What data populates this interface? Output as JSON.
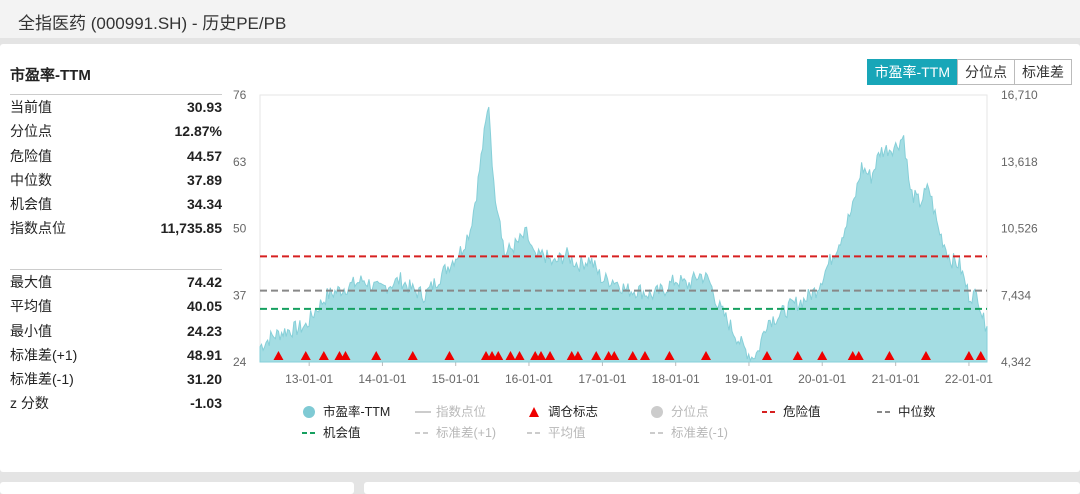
{
  "window": {
    "title": "全指医药 (000991.SH) - 历史PE/PB"
  },
  "panel": {
    "title": "市盈率-TTM"
  },
  "tabs": [
    {
      "label": "市盈率-TTM",
      "active": true
    },
    {
      "label": "分位点",
      "active": false
    },
    {
      "label": "标准差",
      "active": false
    }
  ],
  "stats_current": [
    {
      "label": "当前值",
      "value": "30.93"
    },
    {
      "label": "分位点",
      "value": "12.87%"
    },
    {
      "label": "危险值",
      "value": "44.57"
    },
    {
      "label": "中位数",
      "value": "37.89"
    },
    {
      "label": "机会值",
      "value": "34.34"
    },
    {
      "label": "指数点位",
      "value": "11,735.85"
    }
  ],
  "stats_history": [
    {
      "label": "最大值",
      "value": "74.42"
    },
    {
      "label": "平均值",
      "value": "40.05"
    },
    {
      "label": "最小值",
      "value": "24.23"
    },
    {
      "label": "标准差(+1)",
      "value": "48.91"
    },
    {
      "label": "标准差(-1)",
      "value": "31.20"
    },
    {
      "label": "z 分数",
      "value": "-1.03"
    }
  ],
  "colors": {
    "area_fill": "#a4dde3",
    "area_line": "#86cfd8",
    "danger": "#d62020",
    "median": "#888888",
    "opportunity": "#16a060",
    "marker": "#ee0000",
    "accent": "#18a6b8"
  },
  "chart_data": {
    "type": "area",
    "x_start": "2012-05-01",
    "x_end": "2022-04-01",
    "x_ticks": [
      "13-01-01",
      "14-01-01",
      "15-01-01",
      "16-01-01",
      "17-01-01",
      "18-01-01",
      "19-01-01",
      "20-01-01",
      "21-01-01",
      "22-01-01"
    ],
    "y_left": {
      "min": 24,
      "max": 76,
      "ticks": [
        "24",
        "37",
        "50",
        "63",
        "76"
      ]
    },
    "y_right": {
      "min": 4342,
      "max": 16710,
      "ticks": [
        "4,342",
        "7,434",
        "10,526",
        "13,618",
        "16,710"
      ]
    },
    "series": [
      {
        "name": "市盈率-TTM",
        "points": [
          [
            "2012-05-01",
            27
          ],
          [
            "2012-07-01",
            29
          ],
          [
            "2012-09-01",
            30
          ],
          [
            "2012-11-01",
            30.5
          ],
          [
            "2012-12-15",
            31
          ],
          [
            "2013-02-01",
            34
          ],
          [
            "2013-04-01",
            37
          ],
          [
            "2013-06-01",
            38
          ],
          [
            "2013-08-01",
            39
          ],
          [
            "2013-10-01",
            40
          ],
          [
            "2013-12-15",
            38
          ],
          [
            "2014-02-01",
            39
          ],
          [
            "2014-04-01",
            40
          ],
          [
            "2014-06-01",
            38
          ],
          [
            "2014-08-01",
            37
          ],
          [
            "2014-10-01",
            40
          ],
          [
            "2014-12-01",
            43
          ],
          [
            "2015-02-01",
            46
          ],
          [
            "2015-03-15",
            50
          ],
          [
            "2015-04-15",
            57
          ],
          [
            "2015-05-15",
            66
          ],
          [
            "2015-06-15",
            74.4
          ],
          [
            "2015-07-10",
            58
          ],
          [
            "2015-08-10",
            52
          ],
          [
            "2015-09-01",
            45
          ],
          [
            "2015-11-01",
            47
          ],
          [
            "2015-12-20",
            49
          ],
          [
            "2016-02-01",
            44
          ],
          [
            "2016-03-15",
            45
          ],
          [
            "2016-05-01",
            43
          ],
          [
            "2016-07-01",
            45
          ],
          [
            "2016-09-01",
            43
          ],
          [
            "2016-11-01",
            44
          ],
          [
            "2017-01-01",
            40
          ],
          [
            "2017-03-01",
            40
          ],
          [
            "2017-05-01",
            38
          ],
          [
            "2017-07-01",
            38
          ],
          [
            "2017-09-01",
            37
          ],
          [
            "2017-11-01",
            38
          ],
          [
            "2018-01-01",
            40
          ],
          [
            "2018-03-01",
            39
          ],
          [
            "2018-05-01",
            41
          ],
          [
            "2018-06-15",
            40
          ],
          [
            "2018-08-01",
            35
          ],
          [
            "2018-10-01",
            31
          ],
          [
            "2018-12-01",
            27
          ],
          [
            "2019-01-15",
            25
          ],
          [
            "2019-02-15",
            26
          ],
          [
            "2019-04-01",
            32
          ],
          [
            "2019-06-01",
            33
          ],
          [
            "2019-08-01",
            35
          ],
          [
            "2019-10-01",
            36
          ],
          [
            "2019-12-01",
            38
          ],
          [
            "2020-02-01",
            43
          ],
          [
            "2020-04-01",
            48
          ],
          [
            "2020-06-01",
            54
          ],
          [
            "2020-07-15",
            62
          ],
          [
            "2020-09-01",
            60
          ],
          [
            "2020-10-15",
            65
          ],
          [
            "2021-01-01",
            66
          ],
          [
            "2021-02-10",
            68
          ],
          [
            "2021-03-15",
            57
          ],
          [
            "2021-05-01",
            55
          ],
          [
            "2021-06-15",
            58
          ],
          [
            "2021-08-01",
            50
          ],
          [
            "2021-10-01",
            44
          ],
          [
            "2021-11-15",
            43
          ],
          [
            "2022-01-01",
            37
          ],
          [
            "2022-02-15",
            37
          ],
          [
            "2022-03-15",
            32
          ],
          [
            "2022-04-01",
            31
          ]
        ]
      },
      {
        "name": "危险值",
        "value": 44.57
      },
      {
        "name": "中位数",
        "value": 37.89
      },
      {
        "name": "机会值",
        "value": 34.34
      }
    ],
    "markers": [
      "2012-08-01",
      "2012-12-15",
      "2013-03-15",
      "2013-06-01",
      "2013-07-01",
      "2013-12-01",
      "2014-06-01",
      "2014-12-01",
      "2015-06-01",
      "2015-07-01",
      "2015-08-01",
      "2015-10-01",
      "2015-11-15",
      "2016-02-01",
      "2016-03-01",
      "2016-04-15",
      "2016-08-01",
      "2016-09-01",
      "2016-12-01",
      "2017-02-01",
      "2017-03-01",
      "2017-06-01",
      "2017-08-01",
      "2017-12-01",
      "2018-06-01",
      "2019-04-01",
      "2019-09-01",
      "2020-01-01",
      "2020-06-01",
      "2020-07-01",
      "2020-12-01",
      "2021-06-01",
      "2022-01-01",
      "2022-03-01"
    ],
    "legend": [
      {
        "label": "市盈率-TTM",
        "kind": "dot",
        "color": "#7fcad4"
      },
      {
        "label": "指数点位",
        "kind": "line",
        "color": "#cccccc",
        "faded": true
      },
      {
        "label": "调仓标志",
        "kind": "triangle",
        "color": "#ee0000"
      },
      {
        "label": "分位点",
        "kind": "dot",
        "color": "#cccccc",
        "faded": true
      },
      {
        "label": "危险值",
        "kind": "dash",
        "color": "#d62020"
      },
      {
        "label": "中位数",
        "kind": "dash",
        "color": "#888888"
      },
      {
        "label": "机会值",
        "kind": "dash",
        "color": "#16a060"
      },
      {
        "label": "标准差(+1)",
        "kind": "dash",
        "color": "#cccccc",
        "faded": true
      },
      {
        "label": "平均值",
        "kind": "dash",
        "color": "#cccccc",
        "faded": true
      },
      {
        "label": "标准差(-1)",
        "kind": "dash",
        "color": "#cccccc",
        "faded": true
      }
    ]
  }
}
